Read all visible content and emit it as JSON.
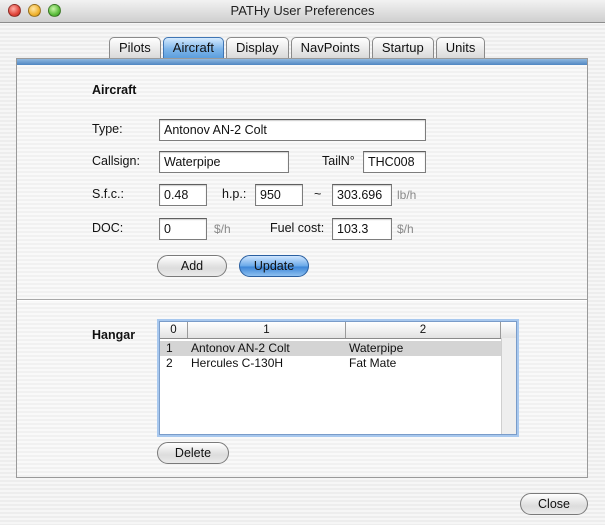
{
  "window": {
    "title": "PATHy User Preferences"
  },
  "tabs": [
    {
      "label": "Pilots"
    },
    {
      "label": "Aircraft"
    },
    {
      "label": "Display"
    },
    {
      "label": "NavPoints"
    },
    {
      "label": "Startup"
    },
    {
      "label": "Units"
    }
  ],
  "selected_tab": "Aircraft",
  "aircraft": {
    "section_label": "Aircraft",
    "type_label": "Type:",
    "type_value": "Antonov AN-2 Colt",
    "callsign_label": "Callsign:",
    "callsign_value": "Waterpipe",
    "tailno_label": "TailN°",
    "tailno_value": "THC008",
    "sfc_label": "S.f.c.:",
    "sfc_value": "0.48",
    "hp_label": "h.p.:",
    "hp_value": "950",
    "approx_symbol": "~",
    "lbh_value": "303.696",
    "lbh_unit": "lb/h",
    "doc_label": "DOC:",
    "doc_value": "0",
    "doc_unit": "$/h",
    "fuelcost_label": "Fuel cost:",
    "fuelcost_value": "103.3",
    "fuelcost_unit": "$/h",
    "add_label": "Add",
    "update_label": "Update"
  },
  "hangar": {
    "section_label": "Hangar",
    "columns": [
      "0",
      "1",
      "2"
    ],
    "rows": [
      {
        "c0": "1",
        "c1": "Antonov AN-2 Colt",
        "c2": "Waterpipe"
      },
      {
        "c0": "2",
        "c1": "Hercules C-130H",
        "c2": "Fat Mate"
      }
    ],
    "delete_label": "Delete"
  },
  "footer": {
    "close_label": "Close"
  }
}
